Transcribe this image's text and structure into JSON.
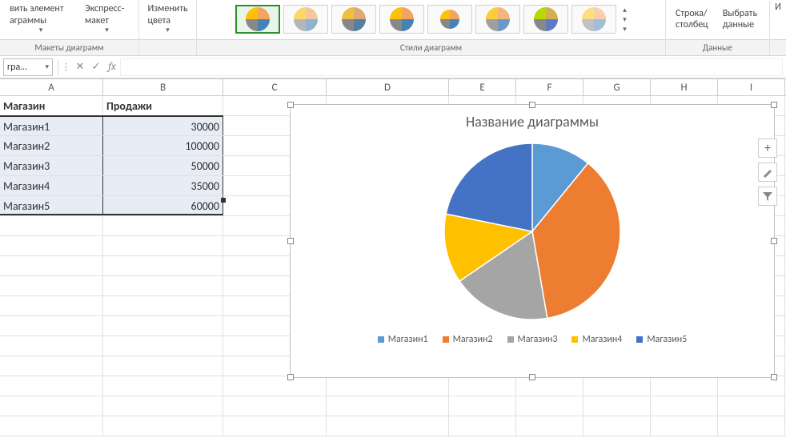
{
  "ribbon": {
    "add_element": "вить элемент аграммы",
    "quick_layout": "Экспресс- макет",
    "change_colors": "Изменить цвета",
    "row_column": "Строка/ столбец",
    "select_data": "Выбрать данные",
    "change_type_cut": "И",
    "group_layouts": "Макеты диаграмм",
    "group_styles": "Стили диаграмм",
    "group_data": "Данные"
  },
  "formula_bar": {
    "name_box": "гра…",
    "value": ""
  },
  "columns": [
    "A",
    "B",
    "C",
    "D",
    "E",
    "F",
    "G",
    "H",
    "I"
  ],
  "table": {
    "header": {
      "a": "Магазин",
      "b": "Продажи"
    },
    "rows": [
      {
        "a": "Магазин1",
        "b": "30000"
      },
      {
        "a": "Магазин2",
        "b": "100000"
      },
      {
        "a": "Магазин3",
        "b": "50000"
      },
      {
        "a": "Магазин4",
        "b": "35000"
      },
      {
        "a": "Магазин5",
        "b": "60000"
      }
    ]
  },
  "chart_data": {
    "type": "pie",
    "title": "Название диаграммы",
    "categories": [
      "Магазин1",
      "Магазин2",
      "Магазин3",
      "Магазин4",
      "Магазин5"
    ],
    "values": [
      30000,
      100000,
      50000,
      35000,
      60000
    ],
    "colors": [
      "#5b9bd5",
      "#ed7d31",
      "#a5a5a5",
      "#ffc000",
      "#4472c4"
    ]
  },
  "side_buttons": {
    "plus": "+",
    "brush": "",
    "filter": ""
  }
}
